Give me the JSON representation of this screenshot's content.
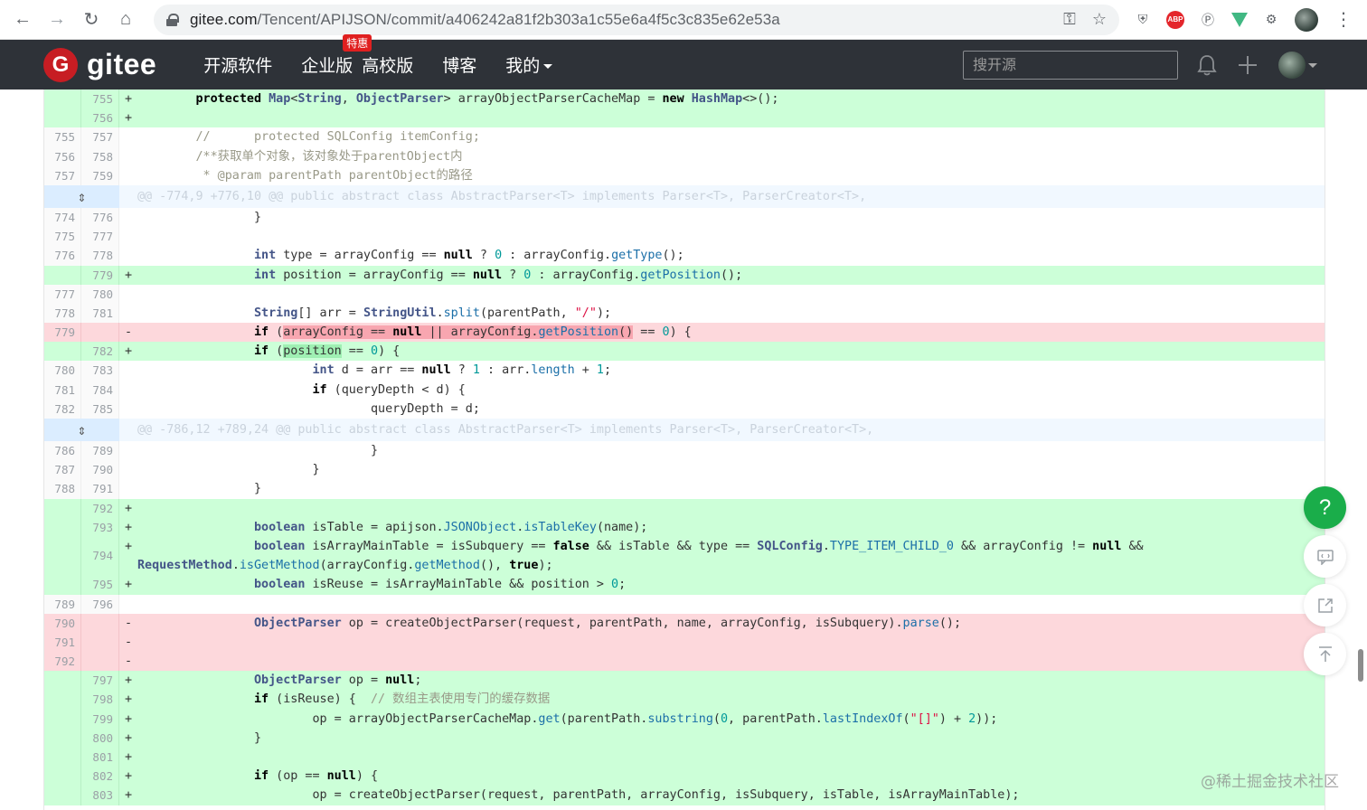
{
  "browser": {
    "url_host": "gitee.com",
    "url_path": "/Tencent/APIJSON/commit/a406242a81f2b303a1c55e6a4f5c3c835e62e53a"
  },
  "header": {
    "logo_letter": "G",
    "logo_text": "gitee",
    "nav": [
      "开源软件",
      "企业版",
      "高校版",
      "博客",
      "我的"
    ],
    "enterprise_badge": "特惠",
    "search_placeholder": "搜开源"
  },
  "diff": {
    "hunk1": "@@ -774,9 +776,10 @@ public abstract class AbstractParser<T> implements Parser<T>, ParserCreator<T>,",
    "hunk2": "@@ -786,12 +789,24 @@ public abstract class AbstractParser<T> implements Parser<T>, ParserCreator<T>,",
    "rows": [
      {
        "old": "",
        "new": "755",
        "mark": "+"
      },
      {
        "old": "",
        "new": "756",
        "mark": "+"
      },
      {
        "old": "755",
        "new": "757",
        "mark": ""
      },
      {
        "old": "756",
        "new": "758",
        "mark": ""
      },
      {
        "old": "757",
        "new": "759",
        "mark": ""
      },
      {
        "old": "774",
        "new": "776",
        "mark": ""
      },
      {
        "old": "775",
        "new": "777",
        "mark": ""
      },
      {
        "old": "776",
        "new": "778",
        "mark": ""
      },
      {
        "old": "",
        "new": "779",
        "mark": "+"
      },
      {
        "old": "777",
        "new": "780",
        "mark": ""
      },
      {
        "old": "778",
        "new": "781",
        "mark": ""
      },
      {
        "old": "779",
        "new": "",
        "mark": "-"
      },
      {
        "old": "",
        "new": "782",
        "mark": "+"
      },
      {
        "old": "780",
        "new": "783",
        "mark": ""
      },
      {
        "old": "781",
        "new": "784",
        "mark": ""
      },
      {
        "old": "782",
        "new": "785",
        "mark": ""
      },
      {
        "old": "786",
        "new": "789",
        "mark": ""
      },
      {
        "old": "787",
        "new": "790",
        "mark": ""
      },
      {
        "old": "788",
        "new": "791",
        "mark": ""
      },
      {
        "old": "",
        "new": "792",
        "mark": "+"
      },
      {
        "old": "",
        "new": "793",
        "mark": "+"
      },
      {
        "old": "",
        "new": "794",
        "mark": "+"
      },
      {
        "old": "",
        "new": "795",
        "mark": "+"
      },
      {
        "old": "789",
        "new": "796",
        "mark": ""
      },
      {
        "old": "790",
        "new": "",
        "mark": "-"
      },
      {
        "old": "791",
        "new": "",
        "mark": "-"
      },
      {
        "old": "792",
        "new": "",
        "mark": "-"
      },
      {
        "old": "",
        "new": "797",
        "mark": "+"
      },
      {
        "old": "",
        "new": "798",
        "mark": "+"
      },
      {
        "old": "",
        "new": "799",
        "mark": "+"
      },
      {
        "old": "",
        "new": "800",
        "mark": "+"
      },
      {
        "old": "",
        "new": "801",
        "mark": "+"
      },
      {
        "old": "",
        "new": "802",
        "mark": "+"
      },
      {
        "old": "",
        "new": "803",
        "mark": "+"
      }
    ]
  },
  "side": {
    "help_label": "?"
  },
  "watermark": "@稀土掘金技术社区"
}
